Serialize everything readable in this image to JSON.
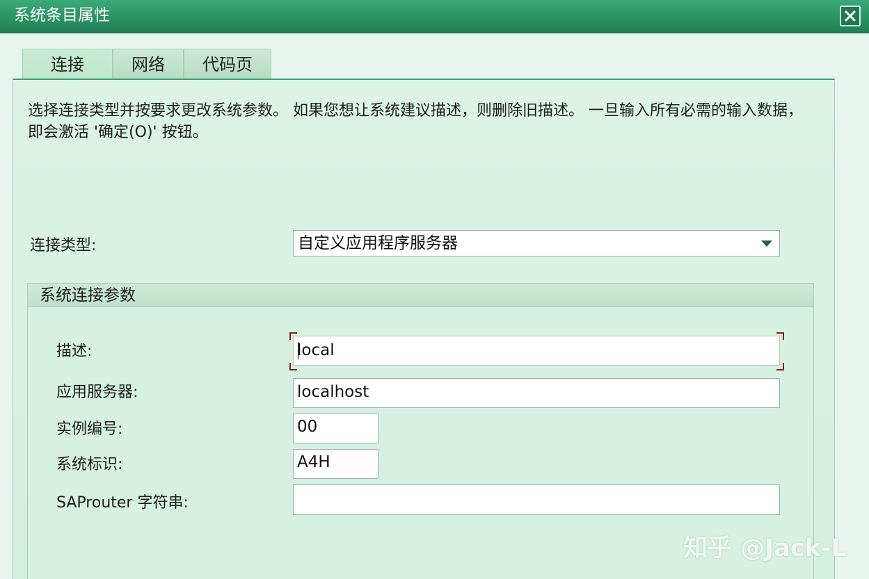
{
  "window": {
    "title": "系统条目属性",
    "close_icon": "close-icon"
  },
  "tabs": [
    {
      "label": "连接",
      "active": true
    },
    {
      "label": "网络",
      "active": false
    },
    {
      "label": "代码页",
      "active": false
    }
  ],
  "intro_text": "选择连接类型并按要求更改系统参数。 如果您想让系统建议描述，则删除旧描述。 一旦输入所有必需的输入数据，即会激活 '确定(O)' 按钮。",
  "connection_type": {
    "label": "连接类型:",
    "value": "自定义应用程序服务器"
  },
  "group": {
    "title": "系统连接参数",
    "fields": {
      "description": {
        "label": "描述:",
        "value": "local"
      },
      "app_server": {
        "label": "应用服务器:",
        "value": "localhost"
      },
      "instance_number": {
        "label": "实例编号:",
        "value": "00"
      },
      "system_id": {
        "label": "系统标识:",
        "value": "A4H"
      },
      "saprouter": {
        "label": "SAProuter 字符串:",
        "value": ""
      }
    }
  },
  "watermark": "知乎 @Jack-L",
  "colors": {
    "titlebar": "#2a9467",
    "panel_bg": "#d6f1e1",
    "focus_corner": "#8a1f12"
  }
}
